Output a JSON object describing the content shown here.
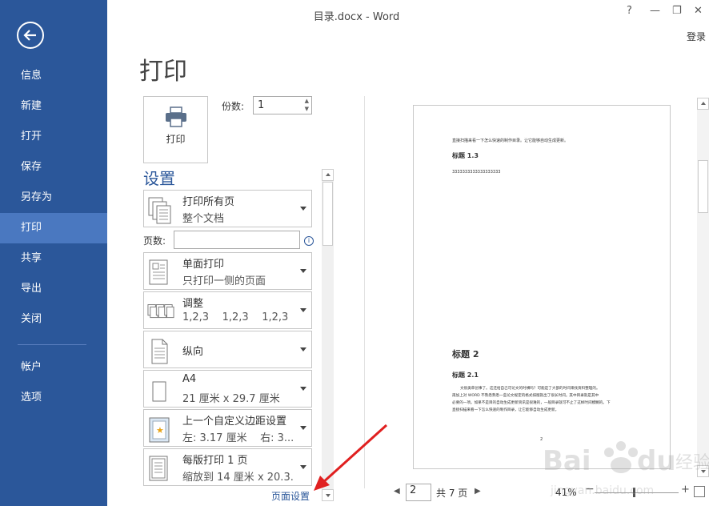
{
  "window": {
    "title": "目录.docx - Word",
    "help": "?",
    "minimize": "—",
    "restore": "❐",
    "close": "✕",
    "signin": "登录"
  },
  "sidebar": {
    "items": [
      {
        "label": "信息"
      },
      {
        "label": "新建"
      },
      {
        "label": "打开"
      },
      {
        "label": "保存"
      },
      {
        "label": "另存为"
      },
      {
        "label": "打印"
      },
      {
        "label": "共享"
      },
      {
        "label": "导出"
      },
      {
        "label": "关闭"
      },
      {
        "label": "帐户"
      },
      {
        "label": "选项"
      }
    ],
    "active": "打印"
  },
  "page_title": "打印",
  "print_button": {
    "label": "打印"
  },
  "copies": {
    "label": "份数:",
    "value": "1"
  },
  "settings": {
    "heading": "设置",
    "pages_label": "页数:",
    "pages_value": "",
    "items": [
      {
        "title": "打印所有页",
        "subtitle": "整个文档",
        "icon": "pages-icon"
      },
      {
        "title": "单面打印",
        "subtitle": "只打印一侧的页面",
        "icon": "single-side-icon"
      },
      {
        "title": "调整",
        "subtitle": "1,2,3    1,2,3    1,2,3",
        "icon": "collate-icon"
      },
      {
        "title": "纵向",
        "subtitle": "",
        "icon": "portrait-icon"
      },
      {
        "title": "A4",
        "subtitle": "21 厘米 x 29.7 厘米",
        "icon": "paper-size-icon"
      },
      {
        "title": "上一个自定义边距设置",
        "subtitle": "左: 3.17 厘米    右: 3...",
        "icon": "margins-icon"
      },
      {
        "title": "每版打印 1 页",
        "subtitle": "缩放到 14 厘米 x 20.3...",
        "icon": "pages-per-sheet-icon"
      }
    ],
    "page_setup_link": "页面设置"
  },
  "preview": {
    "line1": "直接扫描来看一下怎么快速的制作目录。让它能够自动生成更新。",
    "heading13": "标题 1.3",
    "filler": "3333333333333333333",
    "heading2": "标题 2",
    "heading21": "标题 2.1",
    "para": [
      "文很类草创事了。这还给自己可论文的时横吗？可能是了大部的时间来找资料整理的。",
      "再加上对 WORD 不熟悉熟悉一些论文规定的格式排版就出了很长时间。其中目录就是其中",
      "必要的一项。如果不是目的自动生成更新资讯是很难的，一般目录就可不止了这样时间模糊的。下",
      "直接扫描来看一下怎么快速的制作目录，让它能够自动生成更新。"
    ],
    "page_number": "2"
  },
  "navigation": {
    "current_page": "2",
    "total": "共 7 页",
    "zoom": "41%"
  },
  "watermark": {
    "text": "Bai du 经验",
    "sub": "jingyan.baidu.com"
  }
}
